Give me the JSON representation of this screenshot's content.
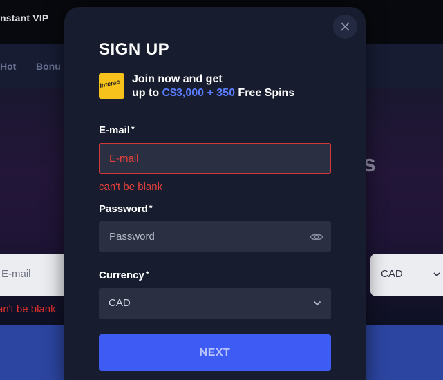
{
  "background": {
    "vip_text": "nstant VIP",
    "nav_items": [
      "Hot",
      "Bonu"
    ],
    "hero_glyph": "s",
    "email_placeholder": "E-mail",
    "currency_value": "CAD",
    "error_text": "an't be blank"
  },
  "modal": {
    "title": "SIGN UP",
    "promo": {
      "logo_text": "Interac",
      "line1": "Join now and get",
      "line2_prefix": "up to ",
      "amount": "C$3,000 + 350",
      "line2_suffix": " Free Spins"
    },
    "email": {
      "label": "E-mail",
      "required": "*",
      "placeholder": "E-mail",
      "value": "",
      "error": "can't be blank"
    },
    "password": {
      "label": "Password",
      "required": "*",
      "placeholder": "Password",
      "value": ""
    },
    "currency": {
      "label": "Currency",
      "required": "*",
      "selected": "CAD"
    },
    "next_label": "NEXT"
  },
  "colors": {
    "modal_bg": "#171c2e",
    "input_bg": "#2a3042",
    "accent_blue": "#3e5cf4",
    "promo_blue": "#5a7cff",
    "error_red": "#e8413c"
  },
  "icons": {
    "close": "close-icon",
    "eye": "eye-icon",
    "chevron": "chevron-down-icon",
    "logo": "interac-logo"
  }
}
